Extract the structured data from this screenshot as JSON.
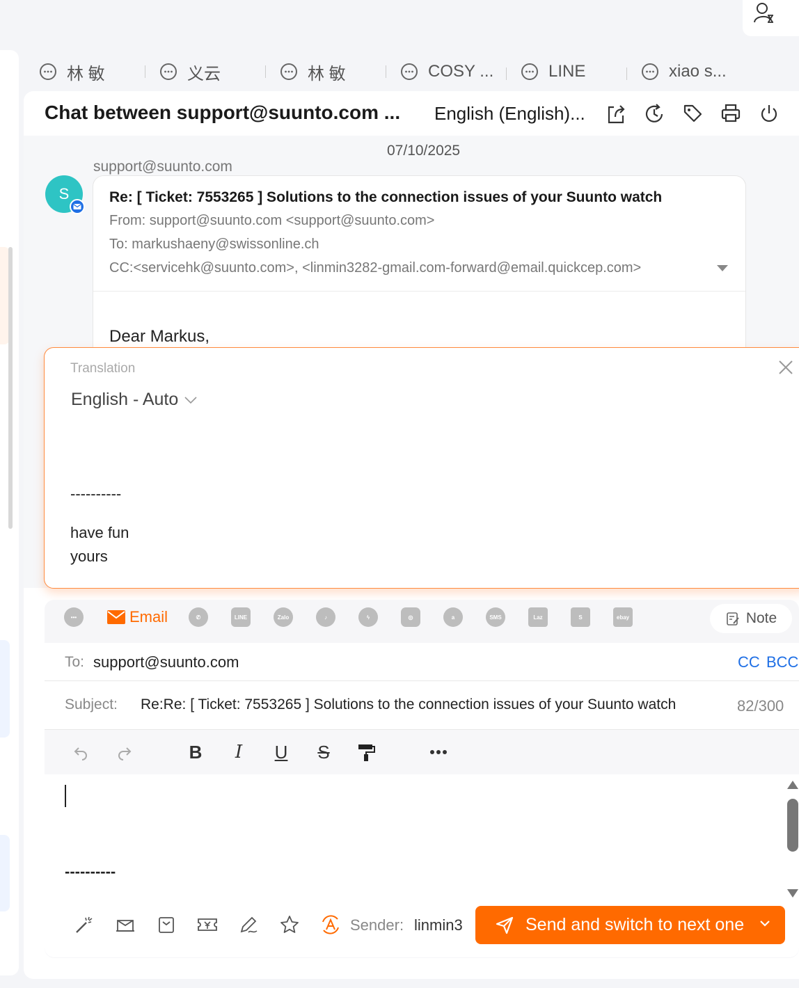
{
  "tabs": [
    {
      "label": "林 敏"
    },
    {
      "label": "义云"
    },
    {
      "label": "林 敏"
    },
    {
      "label": "COSY ..."
    },
    {
      "label": "LINE"
    },
    {
      "label": "xiao s..."
    }
  ],
  "header": {
    "title": "Chat between support@suunto.com ...",
    "language": "English (English)..."
  },
  "message": {
    "date": "07/10/2025",
    "sender": "support@suunto.com",
    "avatar_letter": "S",
    "subject": "Re: [ Ticket: 7553265 ] Solutions to the connection issues of your Suunto watch",
    "from": "From: support@suunto.com <support@suunto.com>",
    "to": "To: markushaeny@swissonline.ch",
    "cc": "CC:<servicehk@suunto.com>, <linmin3282-gmail.com-forward@email.quickcep.com>",
    "greeting": "Dear Markus,"
  },
  "translation": {
    "title": "Translation",
    "language": "English - Auto",
    "line1": "----------",
    "line2": "have fun",
    "line3": "yours"
  },
  "composer": {
    "email_label": "Email",
    "note_label": "Note",
    "to_label": "To:",
    "to_value": "support@suunto.com",
    "cc_label": "CC",
    "bcc_label": "BCC",
    "subject_label": "Subject:",
    "subject_value": "Re:Re: [ Ticket: 7553265 ] Solutions to the connection issues of your Suunto watch",
    "subject_count": "82/300",
    "body_dashes": "----------",
    "sender_label": "Sender:",
    "sender_value": "linmin3",
    "send_label": "Send and switch to next one"
  },
  "colors": {
    "accent": "#ff6a00",
    "link": "#1f6fe5",
    "avatar": "#2ec4c4"
  }
}
